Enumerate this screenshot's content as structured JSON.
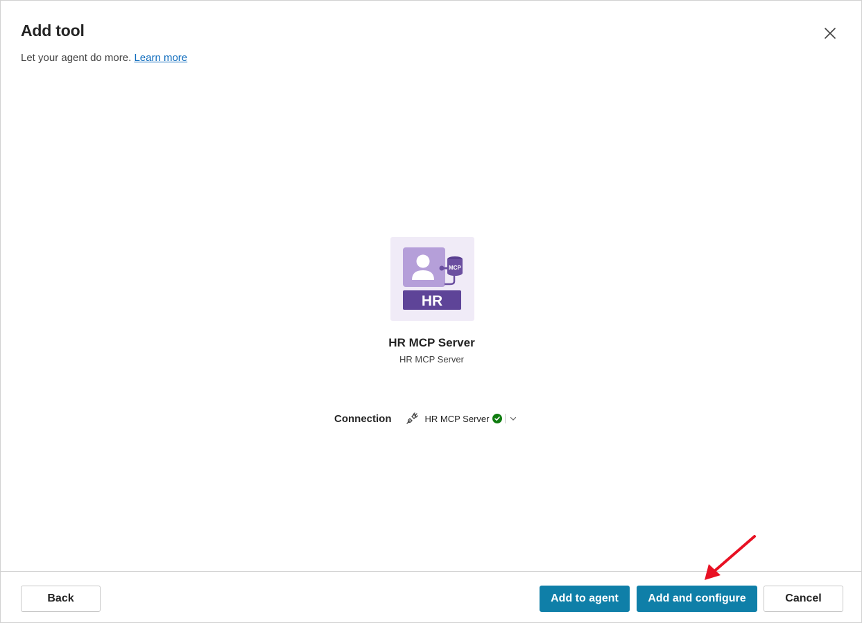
{
  "dialog": {
    "title": "Add tool",
    "subtitle": "Let your agent do more.",
    "learn_more": "Learn more"
  },
  "tool": {
    "icon_text": "HR",
    "icon_badge": "MCP",
    "name": "HR MCP Server",
    "description": "HR MCP Server"
  },
  "connection": {
    "label": "Connection",
    "value": "HR MCP Server",
    "status": "connected"
  },
  "footer": {
    "back_label": "Back",
    "add_to_agent_label": "Add to agent",
    "add_and_configure_label": "Add and configure",
    "cancel_label": "Cancel"
  },
  "colors": {
    "primary": "#0f7fa8",
    "tool_bg": "#f0ebf7",
    "tool_purple": "#6b4fa0",
    "status_green": "#107c10",
    "annotation_arrow": "#e81123"
  }
}
